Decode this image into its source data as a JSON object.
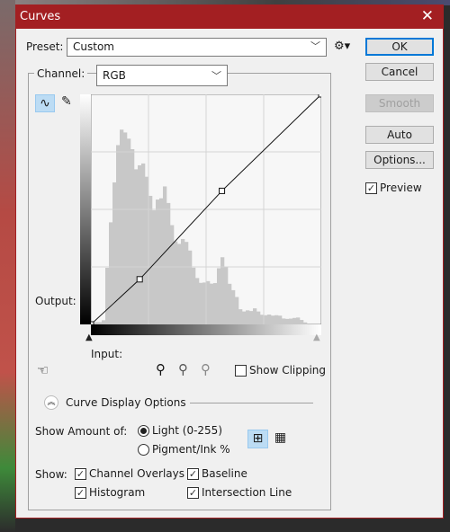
{
  "window": {
    "title": "Curves",
    "close_icon": "close-icon"
  },
  "preset": {
    "label": "Preset:",
    "value": "Custom"
  },
  "channel": {
    "label": "Channel:",
    "value": "RGB"
  },
  "buttons": {
    "ok": "OK",
    "cancel": "Cancel",
    "smooth": "Smooth",
    "auto": "Auto",
    "options": "Options..."
  },
  "preview": {
    "label": "Preview",
    "checked": true
  },
  "graph": {
    "output_label": "Output:",
    "input_label": "Input:",
    "curve_points": [
      [
        0,
        0
      ],
      [
        54,
        50
      ],
      [
        145,
        148
      ],
      [
        255,
        255
      ]
    ],
    "histogram": [
      0.01,
      0.01,
      0.01,
      0.02,
      0.3,
      0.55,
      0.7,
      0.8,
      0.85,
      0.9,
      0.97,
      0.95,
      0.78,
      0.72,
      0.7,
      0.68,
      0.66,
      0.62,
      0.64,
      0.58,
      0.6,
      0.55,
      0.5,
      0.45,
      0.42,
      0.4,
      0.36,
      0.33,
      0.28,
      0.25,
      0.22,
      0.2,
      0.19,
      0.18,
      0.2,
      0.3,
      0.36,
      0.28,
      0.18,
      0.15,
      0.13,
      0.08,
      0.07,
      0.07,
      0.06,
      0.07,
      0.06,
      0.05,
      0.05,
      0.05,
      0.04,
      0.04,
      0.04,
      0.03,
      0.03,
      0.03,
      0.03,
      0.03,
      0.02,
      0.01,
      0,
      0,
      0,
      0
    ]
  },
  "show_clipping": {
    "label": "Show Clipping",
    "checked": false
  },
  "display_options": {
    "title": "Curve Display Options",
    "show_amount_label": "Show Amount of:",
    "light_label": "Light  (0-255)",
    "light_selected": true,
    "pigment_label": "Pigment/Ink %",
    "pigment_selected": false,
    "show_label": "Show:",
    "channel_overlays": "Channel Overlays",
    "baseline": "Baseline",
    "histogram": "Histogram",
    "intersection_line": "Intersection Line"
  },
  "colors": {
    "title_bar": "#a31f22",
    "accent": "#0078d7"
  }
}
